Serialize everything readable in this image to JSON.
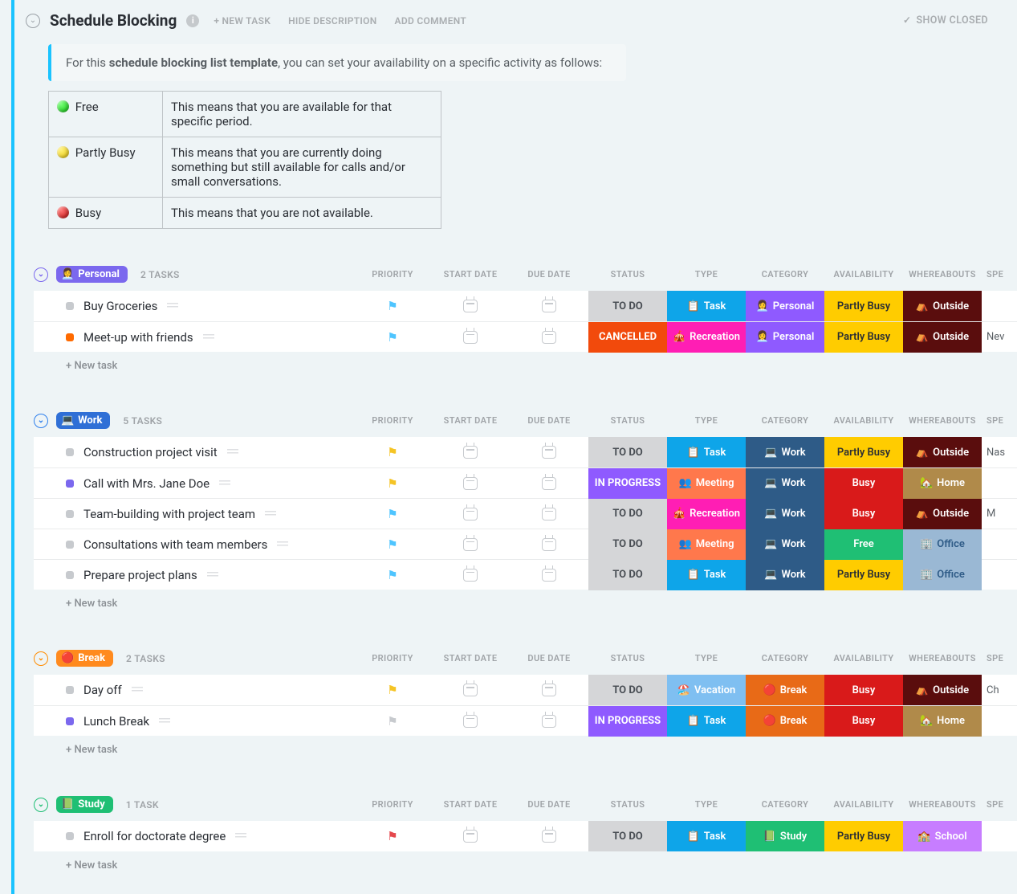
{
  "header": {
    "title": "Schedule Blocking",
    "actions": {
      "new_task": "+ NEW TASK",
      "hide_desc": "HIDE DESCRIPTION",
      "add_comment": "ADD COMMENT",
      "show_closed": "SHOW CLOSED"
    }
  },
  "desc": {
    "pre": "For this ",
    "bold": "schedule blocking list template",
    "post": ", you can set your availability on a specific activity as follows:"
  },
  "legend": [
    {
      "label": "Free",
      "orb": "green",
      "text": "This means that you are available for that specific period."
    },
    {
      "label": "Partly Busy",
      "orb": "yellow",
      "text": "This means that you are currently doing something but still available for calls and/or small conversations."
    },
    {
      "label": "Busy",
      "orb": "red",
      "text": "This means that you are not available."
    }
  ],
  "columns": {
    "priority": "PRIORITY",
    "start": "START DATE",
    "due": "DUE DATE",
    "status": "STATUS",
    "type": "TYPE",
    "category": "CATEGORY",
    "avail": "AVAILABILITY",
    "where": "WHEREABOUTS",
    "spe": "SPE"
  },
  "labels": {
    "new_task": "+ New task"
  },
  "tag_styles": {
    "status": {
      "TO DO": {
        "bg": "#d5d6d8",
        "fg": "#4a4f55"
      },
      "CANCELLED": {
        "bg": "#f24a0c",
        "fg": "#ffffff"
      },
      "IN PROGRESS": {
        "bg": "#8f5aff",
        "fg": "#ffffff"
      }
    },
    "type": {
      "Task": {
        "bg": "#0ea5e9",
        "emoji": "📋"
      },
      "Recreation": {
        "bg": "#ff1eb4",
        "emoji": "🎪"
      },
      "Meeting": {
        "bg": "#ff784c",
        "emoji": "👥"
      },
      "Vacation": {
        "bg": "#7fbff1",
        "emoji": "🏖️"
      }
    },
    "category": {
      "Personal": {
        "bg": "#8f5aff",
        "emoji": "👩‍💼"
      },
      "Work": {
        "bg": "#2e5b87",
        "emoji": "💻"
      },
      "Break": {
        "bg": "#e86a17",
        "emoji": "🔴"
      },
      "Study": {
        "bg": "#1fbf74",
        "emoji": "📗"
      }
    },
    "avail": {
      "Partly Busy": {
        "bg": "#ffcc00",
        "fg": "#2a2e34"
      },
      "Busy": {
        "bg": "#d91a1a",
        "fg": "#ffffff"
      },
      "Free": {
        "bg": "#1fbf74",
        "fg": "#ffffff"
      }
    },
    "where": {
      "Outside": {
        "bg": "#5a0d0d",
        "emoji": "⛺"
      },
      "Home": {
        "bg": "#b08a4a",
        "emoji": "🏡"
      },
      "Office": {
        "bg": "#9ab8d4",
        "emoji": "🏢",
        "fg": "#2e5b87"
      },
      "School": {
        "bg": "#c77dff",
        "emoji": "🏫"
      }
    }
  },
  "groups": [
    {
      "name": "Personal",
      "count": "2 TASKS",
      "badge_bg": "#7b68ee",
      "emoji": "👩‍💼",
      "chev": "purple",
      "rows": [
        {
          "sq": "grey",
          "name": "Buy Groceries",
          "flag": "blue",
          "status": "TO DO",
          "type": "Task",
          "category": "Personal",
          "avail": "Partly Busy",
          "where": "Outside",
          "sp": ""
        },
        {
          "sq": "orange",
          "name": "Meet-up with friends",
          "flag": "blue",
          "status": "CANCELLED",
          "type": "Recreation",
          "category": "Personal",
          "avail": "Partly Busy",
          "where": "Outside",
          "sp": "Nev"
        }
      ]
    },
    {
      "name": "Work",
      "count": "5 TASKS",
      "badge_bg": "#2f6fd6",
      "emoji": "💻",
      "chev": "blue",
      "rows": [
        {
          "sq": "grey",
          "name": "Construction project visit",
          "flag": "yellow",
          "status": "TO DO",
          "type": "Task",
          "category": "Work",
          "avail": "Partly Busy",
          "where": "Outside",
          "sp": "Nas"
        },
        {
          "sq": "purple",
          "name": "Call with Mrs. Jane Doe",
          "flag": "yellow",
          "status": "IN PROGRESS",
          "type": "Meeting",
          "category": "Work",
          "avail": "Busy",
          "where": "Home",
          "sp": ""
        },
        {
          "sq": "grey",
          "name": "Team-building with project team",
          "flag": "blue",
          "status": "TO DO",
          "type": "Recreation",
          "category": "Work",
          "avail": "Busy",
          "where": "Outside",
          "sp": "M"
        },
        {
          "sq": "grey",
          "name": "Consultations with team members",
          "flag": "blue",
          "status": "TO DO",
          "type": "Meeting",
          "category": "Work",
          "avail": "Free",
          "where": "Office",
          "sp": ""
        },
        {
          "sq": "grey",
          "name": "Prepare project plans",
          "flag": "blue",
          "status": "TO DO",
          "type": "Task",
          "category": "Work",
          "avail": "Partly Busy",
          "where": "Office",
          "sp": ""
        }
      ]
    },
    {
      "name": "Break",
      "count": "2 TASKS",
      "badge_bg": "#ff8a1e",
      "emoji": "🔴",
      "chev": "orange",
      "rows": [
        {
          "sq": "grey",
          "name": "Day off",
          "flag": "yellow",
          "status": "TO DO",
          "type": "Vacation",
          "category": "Break",
          "avail": "Busy",
          "where": "Outside",
          "sp": "Ch"
        },
        {
          "sq": "purple",
          "name": "Lunch Break",
          "flag": "grey",
          "status": "IN PROGRESS",
          "type": "Task",
          "category": "Break",
          "avail": "Busy",
          "where": "Home",
          "sp": ""
        }
      ]
    },
    {
      "name": "Study",
      "count": "1 TASK",
      "badge_bg": "#1fbf74",
      "emoji": "📗",
      "chev": "green",
      "rows": [
        {
          "sq": "grey",
          "name": "Enroll for doctorate degree",
          "flag": "red",
          "status": "TO DO",
          "type": "Task",
          "category": "Study",
          "avail": "Partly Busy",
          "where": "School",
          "sp": ""
        }
      ]
    }
  ]
}
